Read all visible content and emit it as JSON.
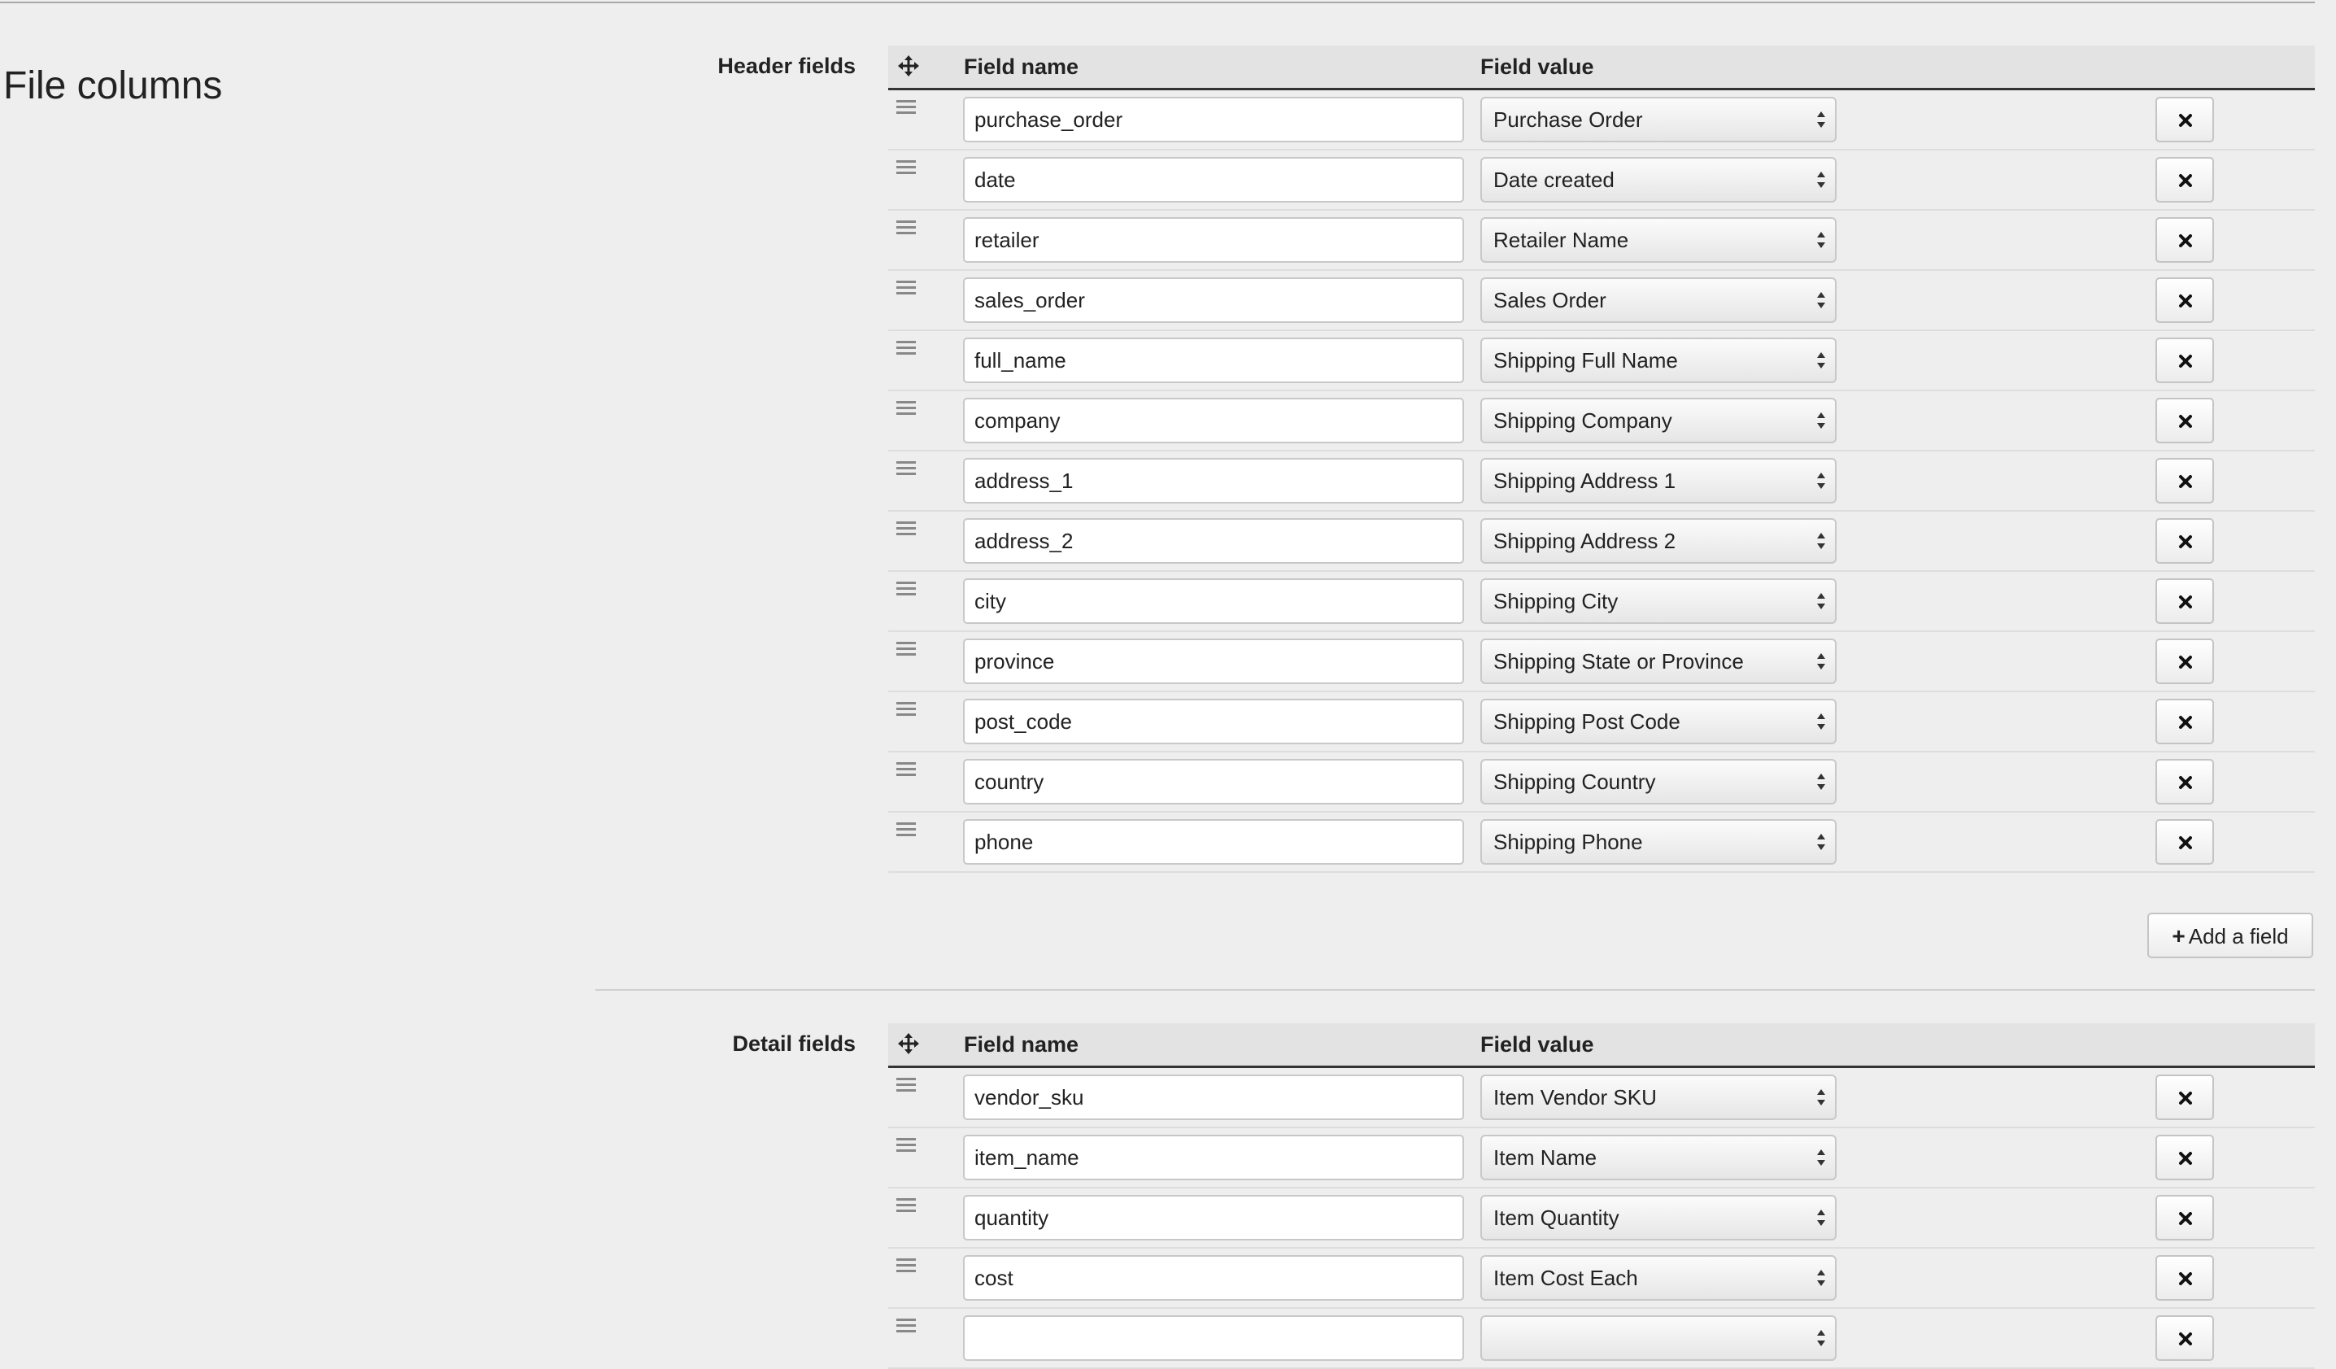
{
  "page": {
    "title": "File columns"
  },
  "header_section": {
    "label": "Header fields",
    "columns": {
      "name": "Field name",
      "value": "Field value"
    },
    "rows": [
      {
        "name": "purchase_order",
        "value": "Purchase Order"
      },
      {
        "name": "date",
        "value": "Date created"
      },
      {
        "name": "retailer",
        "value": "Retailer Name"
      },
      {
        "name": "sales_order",
        "value": "Sales Order"
      },
      {
        "name": "full_name",
        "value": "Shipping Full Name"
      },
      {
        "name": "company",
        "value": "Shipping Company"
      },
      {
        "name": "address_1",
        "value": "Shipping Address 1"
      },
      {
        "name": "address_2",
        "value": "Shipping Address 2"
      },
      {
        "name": "city",
        "value": "Shipping City"
      },
      {
        "name": "province",
        "value": "Shipping State or Province"
      },
      {
        "name": "post_code",
        "value": "Shipping Post Code"
      },
      {
        "name": "country",
        "value": "Shipping Country"
      },
      {
        "name": "phone",
        "value": "Shipping Phone"
      }
    ],
    "add_button_label": "Add a field"
  },
  "detail_section": {
    "label": "Detail fields",
    "columns": {
      "name": "Field name",
      "value": "Field value"
    },
    "rows": [
      {
        "name": "vendor_sku",
        "value": "Item Vendor SKU"
      },
      {
        "name": "item_name",
        "value": "Item Name"
      },
      {
        "name": "quantity",
        "value": "Item Quantity"
      },
      {
        "name": "cost",
        "value": "Item Cost Each"
      },
      {
        "name": "",
        "value": ""
      }
    ]
  },
  "icons": {
    "move": "move-arrows-icon",
    "drag": "drag-handle-icon",
    "remove": "close-icon",
    "select": "select-arrows-icon",
    "add": "plus-icon"
  }
}
